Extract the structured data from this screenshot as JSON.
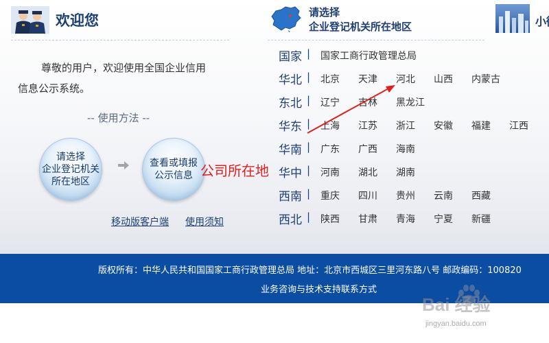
{
  "header": {
    "welcome_title": "欢迎您",
    "choose_line1": "请选择",
    "choose_line2": "企业登记机关所在地区",
    "far_right_title": "小微"
  },
  "intro": {
    "line1": "尊敬的用户，欢迎使用全国企业信用",
    "line2": "信息公示系统。"
  },
  "usage": {
    "title": "-- 使用方法 --",
    "step1": [
      "请选择",
      "企业登记机关",
      "所在地区"
    ],
    "step2": [
      "查看或填报",
      "公示信息"
    ]
  },
  "links": {
    "mobile": "移动版客户端",
    "notice": "使用须知"
  },
  "regions": [
    {
      "name": "国家",
      "provinces": [
        "国家工商行政管理总局"
      ]
    },
    {
      "name": "华北",
      "provinces": [
        "北京",
        "天津",
        "河北",
        "山西",
        "内蒙古"
      ]
    },
    {
      "name": "东北",
      "provinces": [
        "辽宁",
        "吉林",
        "黑龙江"
      ]
    },
    {
      "name": "华东",
      "provinces": [
        "上海",
        "江苏",
        "浙江",
        "安徽",
        "福建",
        "江西"
      ]
    },
    {
      "name": "华南",
      "provinces": [
        "广东",
        "广西",
        "海南"
      ]
    },
    {
      "name": "华中",
      "provinces": [
        "河南",
        "湖北",
        "湖南"
      ]
    },
    {
      "name": "西南",
      "provinces": [
        "重庆",
        "四川",
        "贵州",
        "云南",
        "西藏"
      ]
    },
    {
      "name": "西北",
      "provinces": [
        "陕西",
        "甘肃",
        "青海",
        "宁夏",
        "新疆"
      ]
    }
  ],
  "region_separator": "|",
  "annotation": {
    "text": "公司所在地",
    "color": "#e02020"
  },
  "footer": {
    "line1": "版权所有：中华人民共和国国家工商行政管理总局  地址：北京市西城区三里河东路八号  邮政编码：100820",
    "line2": "业务咨询与技术支持联系方式"
  },
  "watermark": {
    "logo": "Bai  经验",
    "url": "jingyan.baidu.com"
  },
  "colors": {
    "title_blue": "#1d3f74",
    "footer_blue": "#0b4da2",
    "annotation_red": "#e02020"
  },
  "icons": {
    "header_left": "officials-avatar-icon",
    "header_map": "china-map-icon",
    "header_far": "city-skyline-icon",
    "step_arrow": "arrow-right-icon"
  }
}
